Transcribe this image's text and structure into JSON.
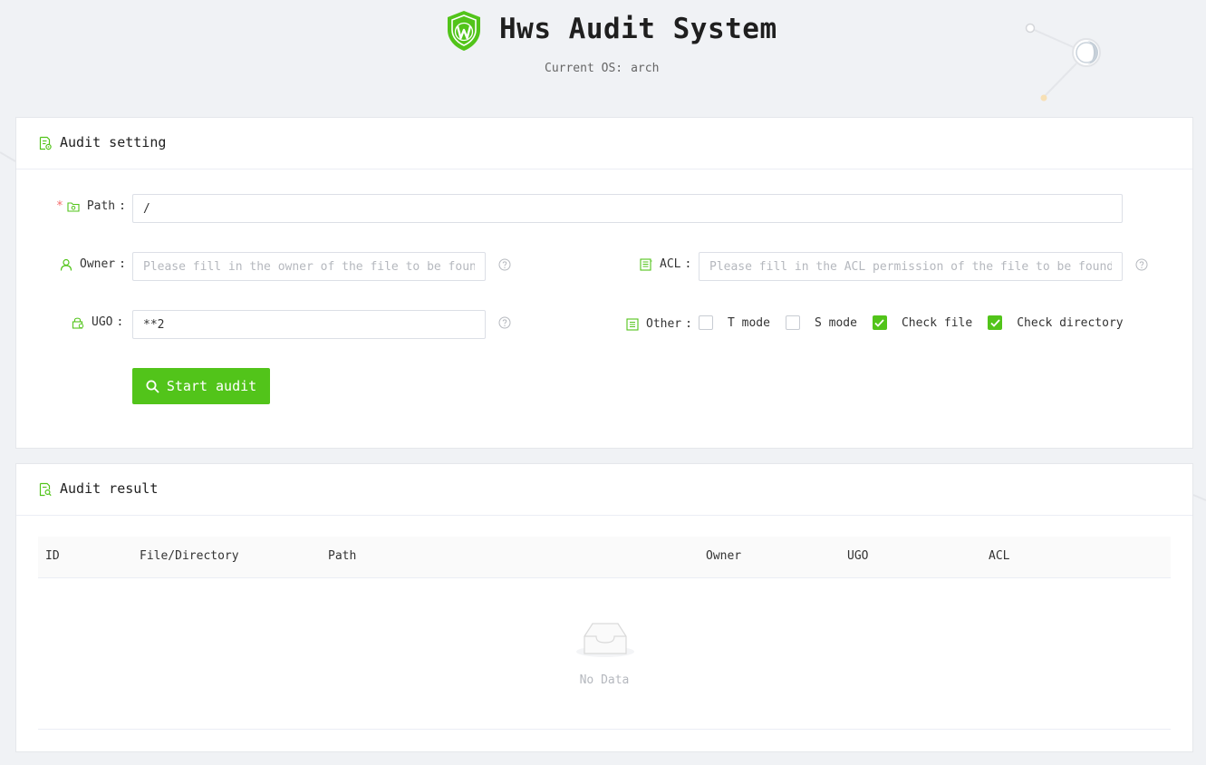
{
  "app": {
    "title": "Hws Audit System",
    "os_label": "Current OS:",
    "os_value": "arch",
    "accent_color": "#52c41a"
  },
  "setting": {
    "title": "Audit setting",
    "path": {
      "label": "Path",
      "value": "/",
      "required": true
    },
    "owner": {
      "label": "Owner",
      "value": "",
      "placeholder": "Please fill in the owner of the file to be found"
    },
    "acl": {
      "label": "ACL",
      "value": "",
      "placeholder": "Please fill in the ACL permission of the file to be found"
    },
    "ugo": {
      "label": "UGO",
      "value": "**2"
    },
    "other": {
      "label": "Other",
      "options": [
        {
          "label": "T mode",
          "checked": false
        },
        {
          "label": "S mode",
          "checked": false
        },
        {
          "label": "Check file",
          "checked": true
        },
        {
          "label": "Check directory",
          "checked": true
        }
      ]
    },
    "start_button": "Start audit"
  },
  "result": {
    "title": "Audit result",
    "columns": [
      "ID",
      "File/Directory",
      "Path",
      "Owner",
      "UGO",
      "ACL"
    ],
    "rows": [],
    "empty_text": "No Data"
  }
}
